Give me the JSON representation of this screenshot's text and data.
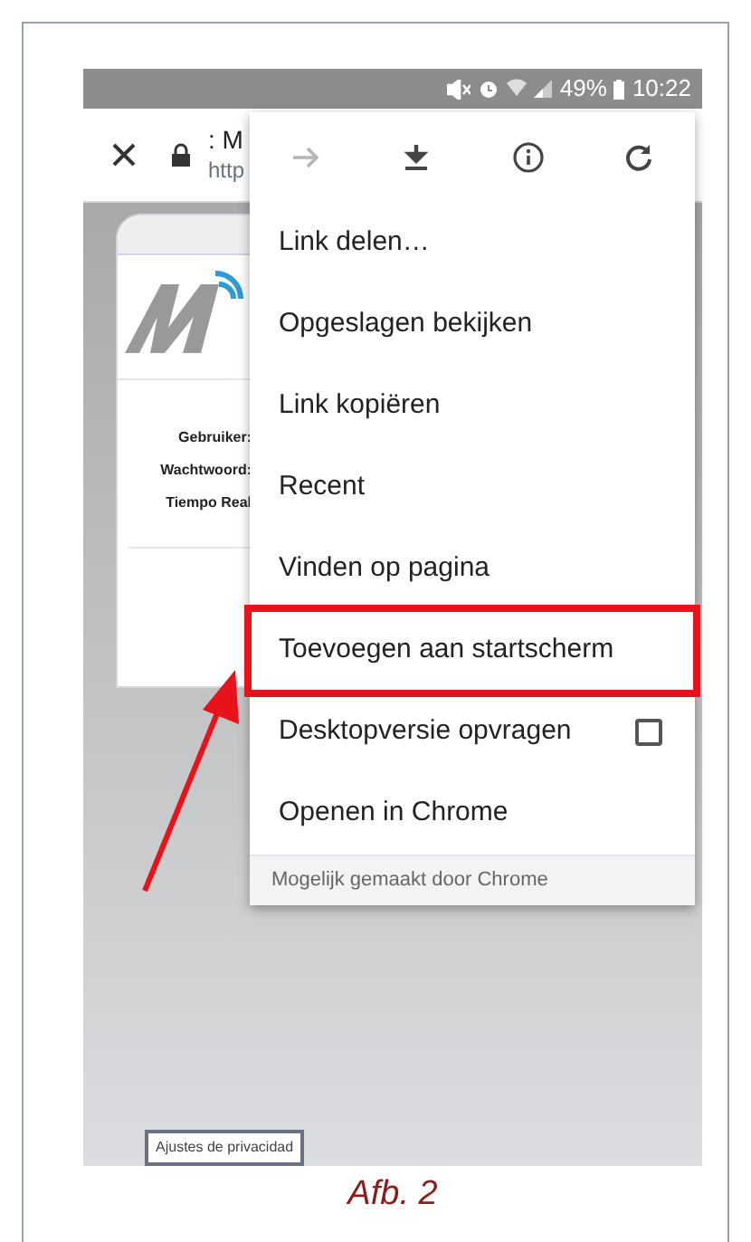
{
  "status_bar": {
    "battery": "49%",
    "time": "10:22"
  },
  "toolbar": {
    "title": ": M",
    "url": "http"
  },
  "page": {
    "fields": [
      "Gebruiker:",
      "Wachtwoord:",
      "Tiempo Real"
    ],
    "privacy_button": "Ajustes de privacidad"
  },
  "menu": {
    "icons": [
      {
        "kind": "forward",
        "disabled": true
      },
      {
        "kind": "download",
        "disabled": false
      },
      {
        "kind": "info",
        "disabled": false
      },
      {
        "kind": "reload",
        "disabled": false
      }
    ],
    "items": [
      {
        "label": "Link delen…",
        "kind": "plain",
        "highlighted": false
      },
      {
        "label": "Opgeslagen bekijken",
        "kind": "plain",
        "highlighted": false
      },
      {
        "label": "Link kopiëren",
        "kind": "plain",
        "highlighted": false
      },
      {
        "label": "Recent",
        "kind": "plain",
        "highlighted": false
      },
      {
        "label": "Vinden op pagina",
        "kind": "plain",
        "highlighted": false
      },
      {
        "label": "Toevoegen aan startscherm",
        "kind": "plain",
        "highlighted": true
      },
      {
        "label": "Desktopversie opvragen",
        "kind": "checkbox",
        "checked": false,
        "highlighted": false
      },
      {
        "label": "Openen in Chrome",
        "kind": "plain",
        "highlighted": false
      }
    ],
    "footer": "Mogelijk gemaakt door Chrome"
  },
  "caption": "Afb. 2"
}
